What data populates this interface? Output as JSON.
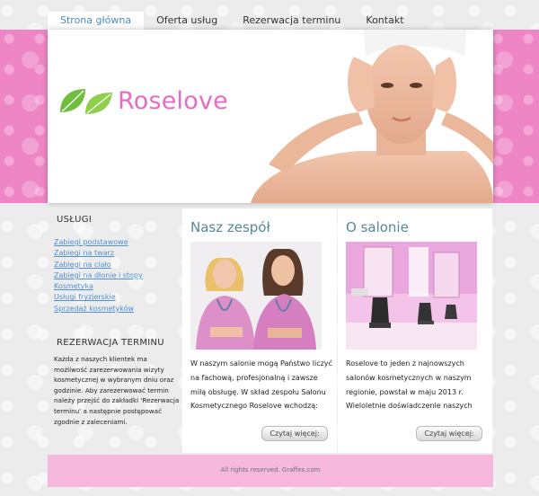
{
  "nav": {
    "items": [
      {
        "label": "Strona główna"
      },
      {
        "label": "Oferta usług"
      },
      {
        "label": "Rezerwacja terminu"
      },
      {
        "label": "Kontakt"
      }
    ]
  },
  "header": {
    "logo_text": "Roselove",
    "colors": {
      "band": "#ee86c6",
      "logo": "#e56cc3",
      "leaf": "#6fbe3e"
    }
  },
  "sidebar": {
    "services_title": "USŁUGI",
    "links": [
      "Zabiegi podstawowe",
      "Zabiegi na twarz",
      "Zabiegi na ciało",
      "Zabiegi na dłonie i stopy",
      "Kosmetyka",
      "Usługi fryzjerskie",
      "Sprzedaż kosmetyków"
    ],
    "reservation_title": "REZERWACJA TERMINU",
    "reservation_text": "Każda z naszych klientek ma możliwość zarezerwowania wizyty kosmetycznej w wybranym dniu oraz godzinie. Aby zarezerwować termin należy przejść do zakładki 'Rezerwacja terminu' a następnie postępować zgodnie z zaleceniami."
  },
  "team": {
    "title": "Nasz zespół",
    "text": "W naszym salonie mogą Państwo liczyć na fachową, profesjonalną i zawsze miłą obsługę. W skład zespołu Salonu Kosmetycznego Roselove wchodzą:",
    "button": "Czytaj więcej:"
  },
  "salon": {
    "title": "O salonie",
    "text": "Roselove to jeden z najnowszych salonów kosmetycznych w naszym regionie, powstał w maju 2013 r. Wieloletnie doświadczenie naszych pracowników gwarantuje wysoką",
    "button": "Czytaj więcej:"
  },
  "footer": {
    "text": "All rights reserved. Graffes.com"
  }
}
